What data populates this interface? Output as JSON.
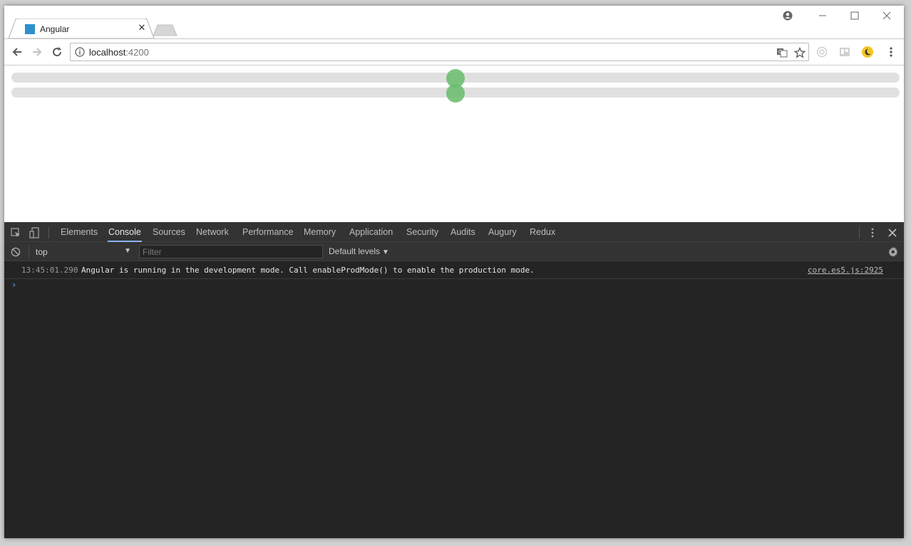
{
  "browser": {
    "tab": {
      "title": "Angular",
      "close_glyph": "✕"
    },
    "address": {
      "host": "localhost",
      "port": ":4200"
    }
  },
  "page": {
    "sliders": [
      {
        "value_fraction": 0.5
      },
      {
        "value_fraction": 0.5
      }
    ],
    "colors": {
      "track": "#e0e0e0",
      "thumb": "#66bb6a"
    }
  },
  "devtools": {
    "tabs": [
      "Elements",
      "Console",
      "Sources",
      "Network",
      "Performance",
      "Memory",
      "Application",
      "Security",
      "Audits",
      "Augury",
      "Redux"
    ],
    "active_tab": "Console",
    "console": {
      "context": "top",
      "filter_placeholder": "Filter",
      "levels_label": "Default levels",
      "messages": [
        {
          "timestamp": "13:45:01.290",
          "text": "Angular is running in the development mode. Call enableProdMode() to enable the production mode.",
          "source": "core.es5.js:2925"
        }
      ]
    }
  }
}
